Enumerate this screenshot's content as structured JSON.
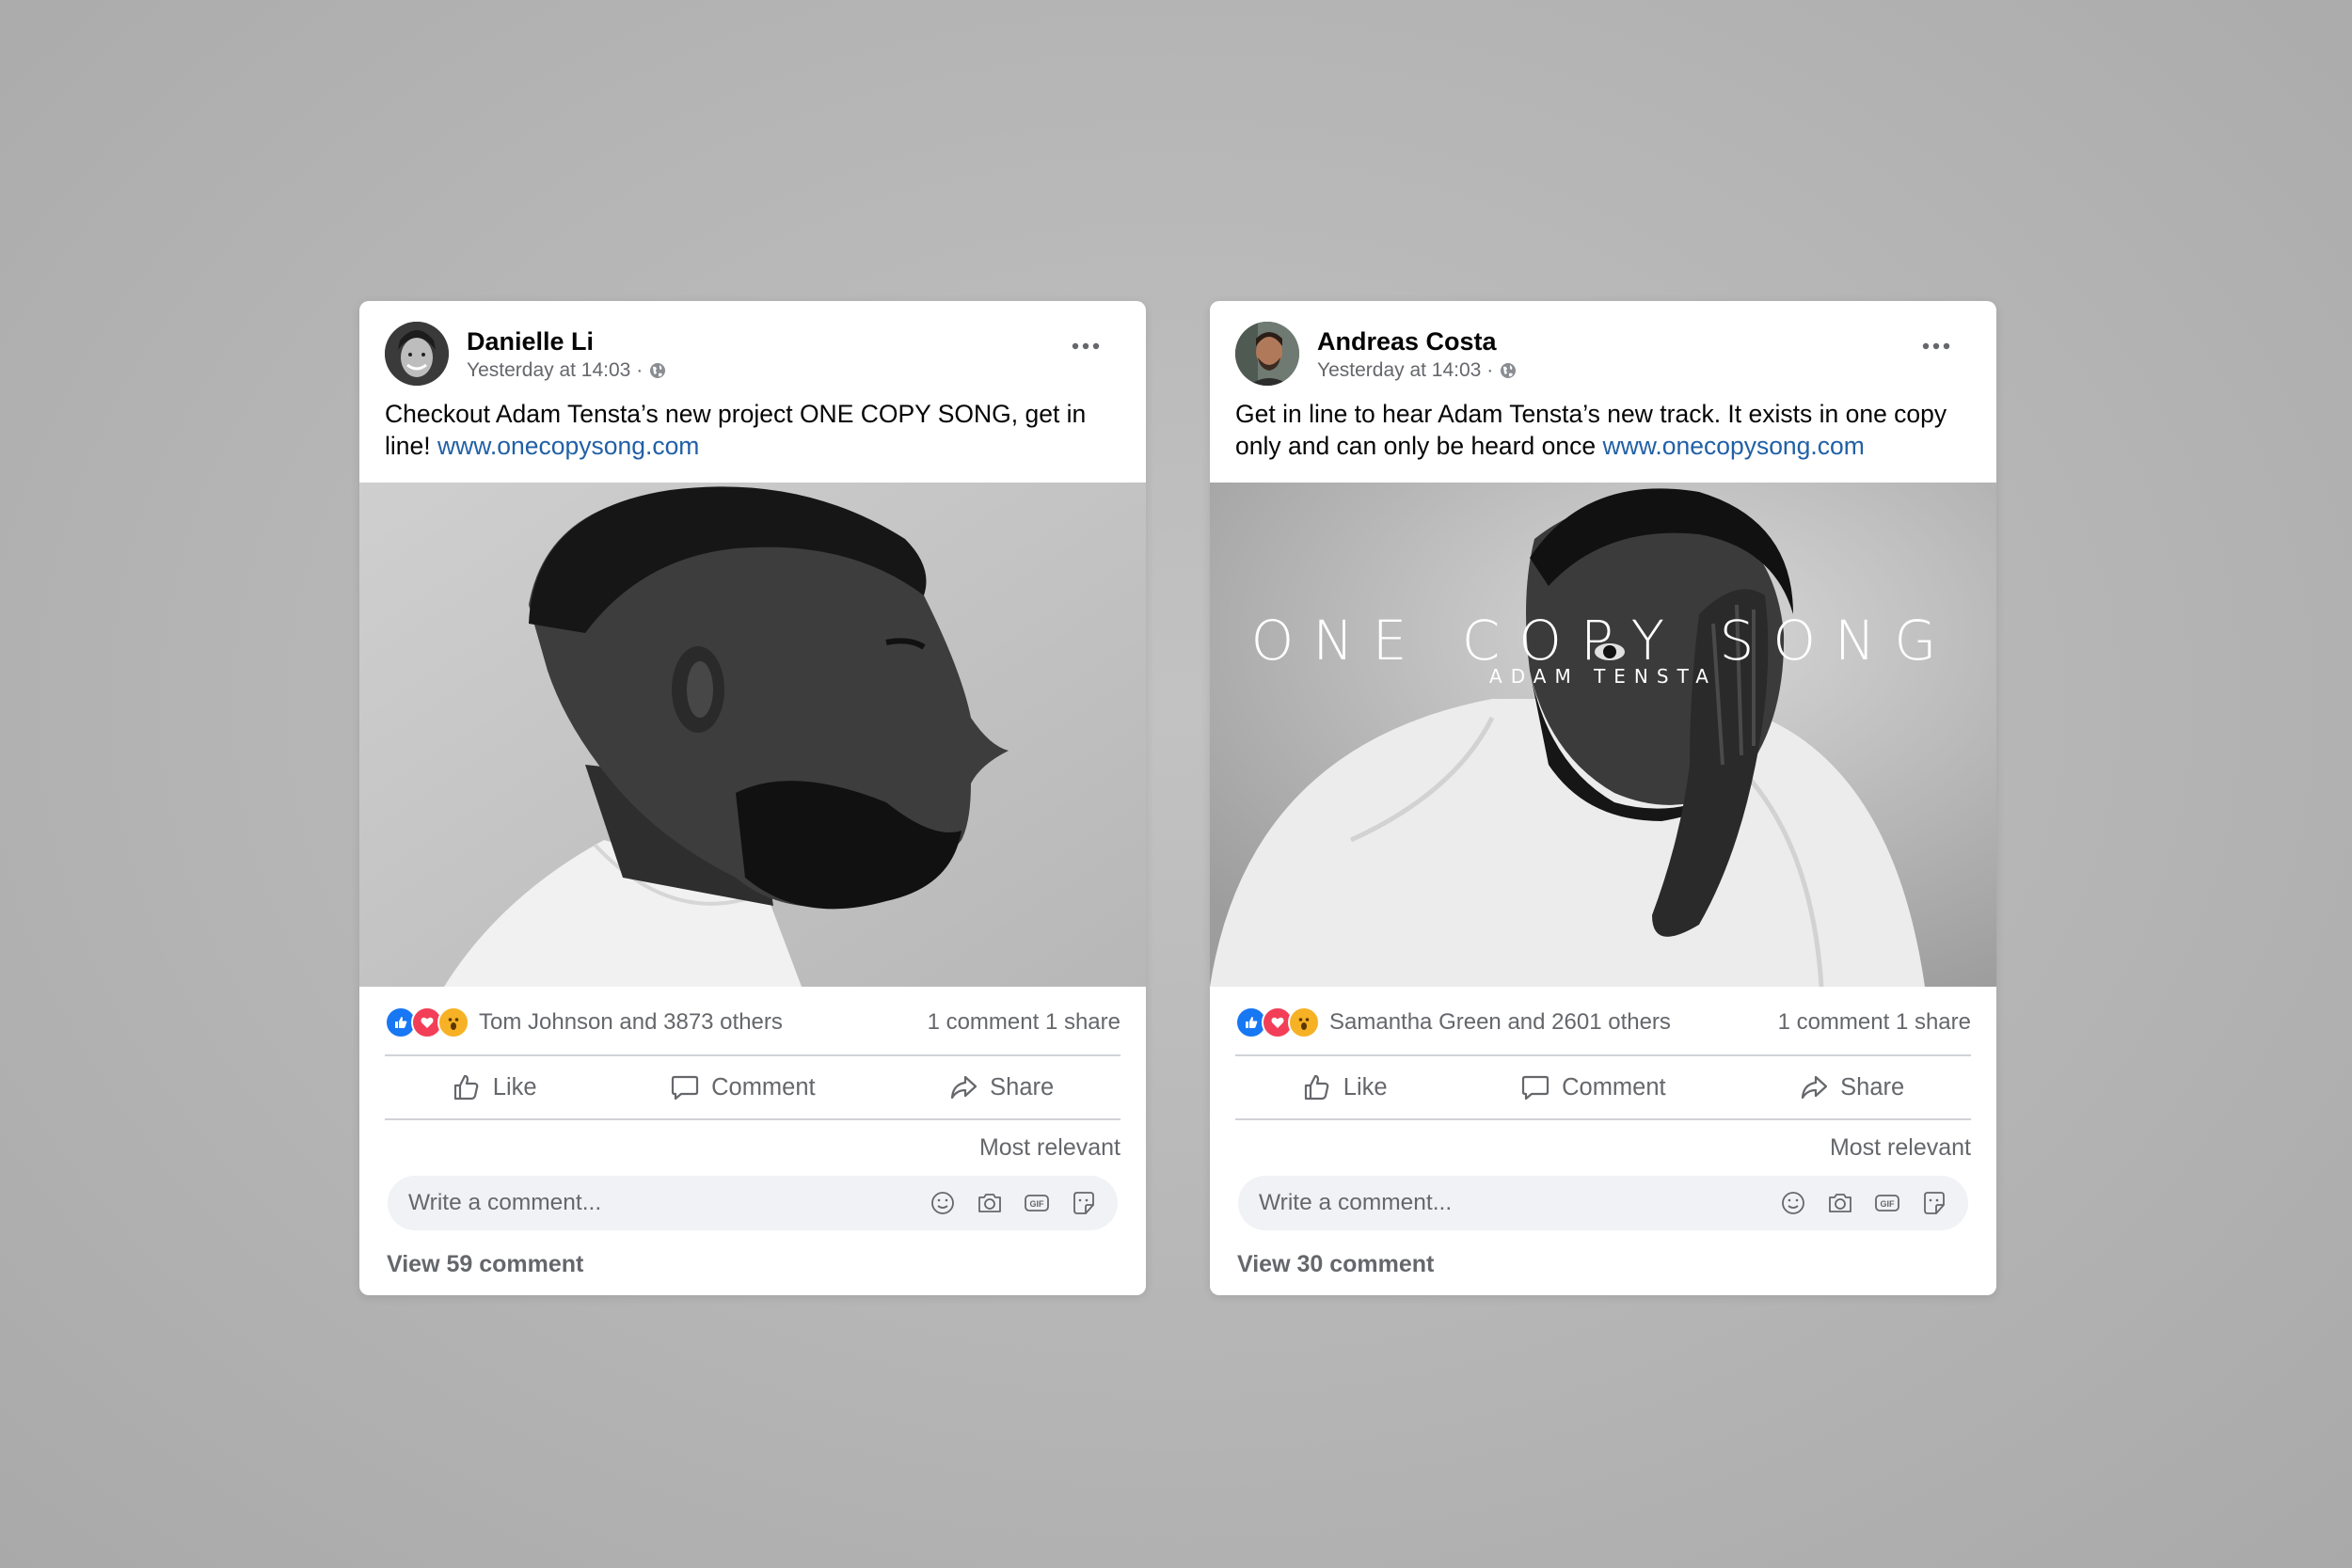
{
  "posts": [
    {
      "author": "Danielle Li",
      "time": "Yesterday at 14:03 ·",
      "text": "Checkout Adam Tensta’s new project ONE COPY SONG, get in line! ",
      "link": "www.onecopysong.com",
      "reactors": "Tom Johnson and 3873 others",
      "counts": "1 comment 1 share",
      "actions": {
        "like": "Like",
        "comment": "Comment",
        "share": "Share"
      },
      "sort": "Most relevant",
      "comment_placeholder": "Write a comment...",
      "view_comments": "View 59 comment",
      "image": {
        "overlay_title": "",
        "overlay_subtitle": ""
      }
    },
    {
      "author": "Andreas Costa",
      "time": "Yesterday at 14:03 ·",
      "text": "Get in line to hear Adam Tensta’s new track. It exists in one copy only and can only be heard once ",
      "link": "www.onecopysong.com",
      "reactors": "Samantha Green and 2601 others",
      "counts": "1 comment 1 share",
      "actions": {
        "like": "Like",
        "comment": "Comment",
        "share": "Share"
      },
      "sort": "Most relevant",
      "comment_placeholder": "Write a comment...",
      "view_comments": "View 30 comment",
      "image": {
        "overlay_title": "ONE COPY SONG",
        "overlay_subtitle": "ADAM TENSTA"
      }
    }
  ],
  "colors": {
    "like_blue": "#1877f2",
    "love_red": "#f33e58",
    "wow_yellow": "#f7b125",
    "link_blue": "#2160a6",
    "secondary_text": "#65676b"
  },
  "icons": [
    "globe-icon",
    "more-options-icon",
    "like-reaction-icon",
    "love-reaction-icon",
    "wow-reaction-icon",
    "thumbs-up-icon",
    "speech-bubble-icon",
    "share-arrow-icon",
    "emoji-icon",
    "camera-icon",
    "gif-icon",
    "sticker-icon"
  ]
}
